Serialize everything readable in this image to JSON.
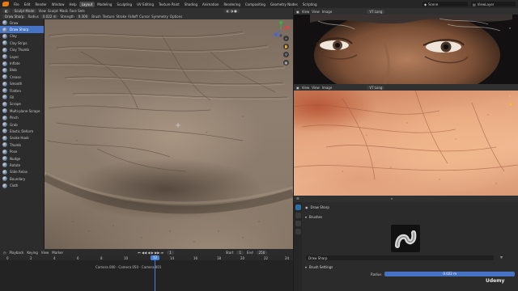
{
  "menubar": {
    "menus": [
      "File",
      "Edit",
      "Render",
      "Window",
      "Help"
    ],
    "workspaces": [
      "Layout",
      "Modeling",
      "Sculpting",
      "UV Editing",
      "Texture Paint",
      "Shading",
      "Animation",
      "Rendering",
      "Compositing",
      "Geometry Nodes",
      "Scripting"
    ],
    "active_workspace": "Layout",
    "scene": "Scene",
    "view_layer": "ViewLayer"
  },
  "viewport_header": {
    "mode": "Sculpt Mode",
    "menus": [
      "View",
      "Sculpt",
      "Mask",
      "Face Sets"
    ],
    "brush": "Draw Sharp",
    "radius_label": "Radius",
    "radius_value": "0.022 m",
    "strength_label": "Strength",
    "strength_value": "0.300",
    "right_items": [
      "Brush",
      "Texture",
      "Stroke",
      "Falloff",
      "Cursor"
    ],
    "symmetry": "Symmetry",
    "options": "Options"
  },
  "brushes": [
    {
      "label": "Draw",
      "selected": false
    },
    {
      "label": "Draw Sharp",
      "selected": true
    },
    {
      "label": "Clay",
      "selected": false
    },
    {
      "label": "Clay Strips",
      "selected": false
    },
    {
      "label": "Clay Thumb",
      "selected": false
    },
    {
      "label": "Layer",
      "selected": false
    },
    {
      "label": "Inflate",
      "selected": false
    },
    {
      "label": "Blob",
      "selected": false
    },
    {
      "label": "Crease",
      "selected": false
    },
    {
      "label": "Smooth",
      "selected": false
    },
    {
      "label": "Flatten",
      "selected": false
    },
    {
      "label": "Fill",
      "selected": false
    },
    {
      "label": "Scrape",
      "selected": false
    },
    {
      "label": "Multi-plane Scrape",
      "selected": false
    },
    {
      "label": "Pinch",
      "selected": false
    },
    {
      "label": "Grab",
      "selected": false
    },
    {
      "label": "Elastic Deform",
      "selected": false
    },
    {
      "label": "Snake Hook",
      "selected": false
    },
    {
      "label": "Thumb",
      "selected": false
    },
    {
      "label": "Pose",
      "selected": false
    },
    {
      "label": "Nudge",
      "selected": false
    },
    {
      "label": "Rotate",
      "selected": false
    },
    {
      "label": "Slide Relax",
      "selected": false
    },
    {
      "label": "Boundary",
      "selected": false
    },
    {
      "label": "Cloth",
      "selected": false
    }
  ],
  "image_editor_top": {
    "menus": [
      "View",
      "View",
      "Image"
    ],
    "image_name": "VT Long"
  },
  "image_editor_bottom": {
    "menus": [
      "View",
      "View",
      "Image"
    ],
    "image_name": "VT Long"
  },
  "timeline": {
    "menus": [
      "Playback",
      "Keying",
      "View",
      "Marker"
    ],
    "current_frame": "1",
    "start_label": "Start",
    "start": "1",
    "end_label": "End",
    "end": "250",
    "ticks": [
      "0",
      "2",
      "4",
      "6",
      "8",
      "10",
      "12",
      "14",
      "16",
      "18",
      "20",
      "22",
      "24"
    ],
    "markers_text": "Camera 000 · Camera 050 · Camera 001"
  },
  "properties": {
    "brush_field": "Draw Sharp",
    "brushes_section": "Brushes",
    "brush_name": "Draw Sharp",
    "brush_settings": "Brush Settings",
    "radius_label": "Radius",
    "radius_value": "0.022 m"
  },
  "watermark": "Udemy"
}
